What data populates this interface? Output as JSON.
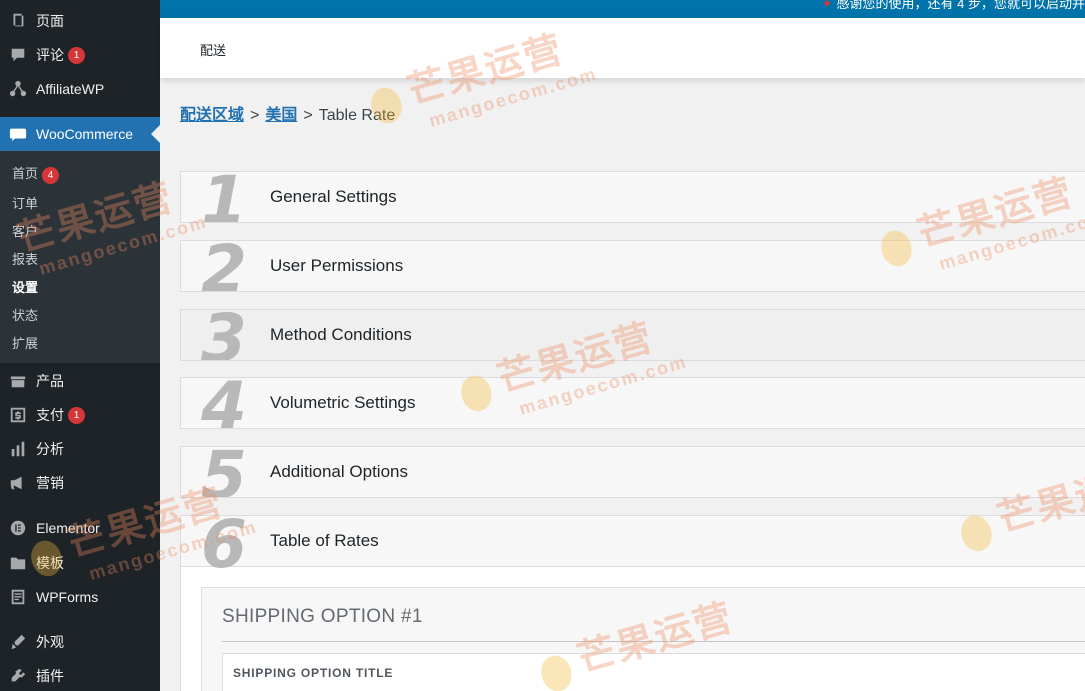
{
  "sidebar": {
    "items": [
      {
        "label": "页面",
        "icon": "pages-icon",
        "badge": ""
      },
      {
        "label": "评论",
        "icon": "comments-icon",
        "badge": "1"
      },
      {
        "label": "AffiliateWP",
        "icon": "affiliatewp-icon",
        "badge": ""
      },
      {
        "label": "WooCommerce",
        "icon": "woocommerce-icon",
        "badge": ""
      },
      {
        "label": "产品",
        "icon": "products-icon",
        "badge": ""
      },
      {
        "label": "支付",
        "icon": "payments-icon",
        "badge": "1"
      },
      {
        "label": "分析",
        "icon": "analytics-icon",
        "badge": ""
      },
      {
        "label": "营销",
        "icon": "marketing-icon",
        "badge": ""
      },
      {
        "label": "Elementor",
        "icon": "elementor-icon",
        "badge": ""
      },
      {
        "label": "模板",
        "icon": "templates-icon",
        "badge": ""
      },
      {
        "label": "WPForms",
        "icon": "wpforms-icon",
        "badge": ""
      },
      {
        "label": "外观",
        "icon": "appearance-icon",
        "badge": ""
      },
      {
        "label": "插件",
        "icon": "plugins-icon",
        "badge": ""
      }
    ],
    "submenu": [
      {
        "label": "首页",
        "badge": "4"
      },
      {
        "label": "订单",
        "badge": ""
      },
      {
        "label": "客户",
        "badge": ""
      },
      {
        "label": "报表",
        "badge": ""
      },
      {
        "label": "设置",
        "badge": ""
      },
      {
        "label": "状态",
        "badge": ""
      },
      {
        "label": "扩展",
        "badge": ""
      }
    ],
    "current_submenu": "设置"
  },
  "topbar": {
    "notice": "感谢您的使用，还有 4 步，您就可以启动并"
  },
  "header": {
    "title": "配送"
  },
  "breadcrumb": {
    "zones": "配送区域",
    "region": "美国",
    "separator": ">",
    "current": "Table Rate"
  },
  "panels": [
    {
      "number": "1",
      "title": "General Settings"
    },
    {
      "number": "2",
      "title": "User Permissions"
    },
    {
      "number": "3",
      "title": "Method Conditions"
    },
    {
      "number": "4",
      "title": "Volumetric Settings"
    },
    {
      "number": "5",
      "title": "Additional Options"
    },
    {
      "number": "6",
      "title": "Table of Rates"
    }
  ],
  "shipping_option": {
    "title": "SHIPPING OPTION #1",
    "field_label": "SHIPPING OPTION TITLE"
  },
  "watermark": {
    "cn": "芒果运营",
    "en": "mangoecom.com"
  },
  "colors": {
    "sidebar": "#1d2327",
    "submenu": "#2c3338",
    "accent": "#2271b1",
    "badge": "#d63638",
    "topbar": "#0073aa"
  }
}
